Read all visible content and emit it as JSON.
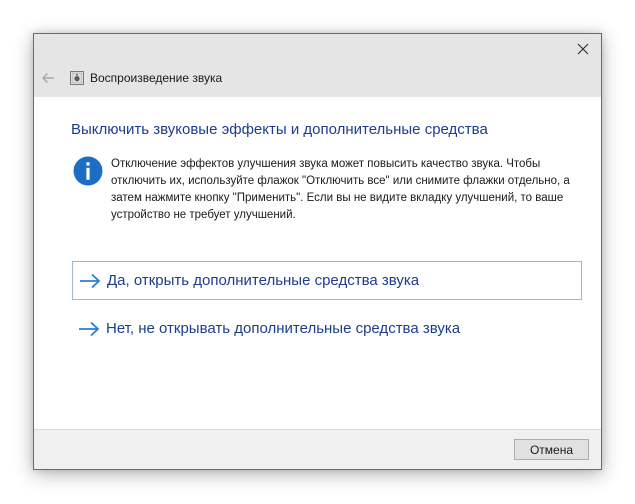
{
  "window": {
    "title": "Воспроизведение звука"
  },
  "dialog": {
    "heading": "Выключить звуковые эффекты и дополнительные средства",
    "info_text": "Отключение эффектов улучшения звука может повысить качество звука. Чтобы отключить их, используйте флажок \"Отключить все\" или снимите флажки отдельно, а затем нажмите кнопку \"Применить\". Если вы не видите вкладку улучшений, то ваше устройство не требует улучшений.",
    "options": [
      {
        "label": "Да, открыть дополнительные средства звука"
      },
      {
        "label": "Нет, не открывать дополнительные средства звука"
      }
    ],
    "cancel_label": "Отмена"
  },
  "icons": {
    "close": "close-icon",
    "back": "back-arrow-icon",
    "app": "speaker-icon",
    "info": "info-icon",
    "option_arrow": "arrow-right-icon"
  },
  "colors": {
    "accent": "#1c3d8f",
    "info_circle": "#1b6ec2",
    "arrow": "#2a7fd4",
    "titlebar": "#e5e5e5",
    "footer": "#f0f0f0"
  }
}
